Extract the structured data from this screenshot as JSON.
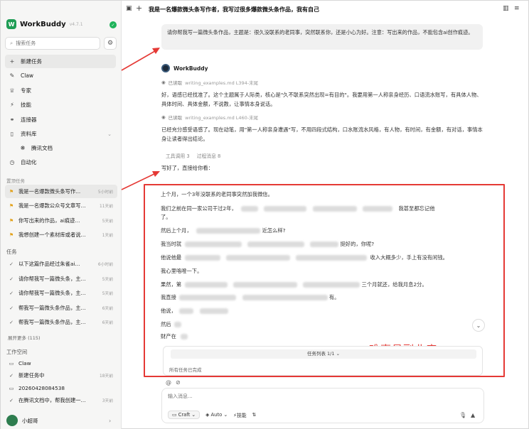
{
  "sidebar": {
    "brand_name": "WorkBuddy",
    "brand_version": "v4.7.1",
    "search_placeholder": "搜索任务",
    "nav": [
      {
        "label": "新建任务",
        "icon": "plus-icon"
      },
      {
        "label": "Claw",
        "icon": "claw-icon"
      },
      {
        "label": "专家",
        "icon": "expert-icon"
      },
      {
        "label": "技能",
        "icon": "skills-icon"
      },
      {
        "label": "连接器",
        "icon": "connector-icon"
      },
      {
        "label": "资料库",
        "icon": "library-icon"
      },
      {
        "label": "腾讯文档",
        "icon": "docs-icon"
      },
      {
        "label": "自动化",
        "icon": "automation-icon"
      }
    ],
    "pinned_label": "置顶任务",
    "pinned": [
      {
        "title": "我是一名爆款微头条写作...",
        "time": "5小时前"
      },
      {
        "title": "我是一名爆款公众号文章写...",
        "time": "11天前"
      },
      {
        "title": "你写出来的作品，ai痕迹...",
        "time": "5天前"
      },
      {
        "title": "我想创建一个素材库或者说...",
        "time": "1天前"
      }
    ],
    "tasks_label": "任务",
    "tasks": [
      {
        "title": "以下这篇作品经过朱雀ai...",
        "time": "6小时前"
      },
      {
        "title": "请你帮我写一篇微头条，主...",
        "time": "5天前"
      },
      {
        "title": "请你帮我写一篇微头条，主...",
        "time": "5天前"
      },
      {
        "title": "帮我写一篇微头条作品，主...",
        "time": "6天前"
      },
      {
        "title": "帮我写一篇微头条作品，主...",
        "time": "6天前"
      }
    ],
    "expand_more": "展开更多 (115)",
    "workspace_label": "工作空间",
    "workspace": [
      {
        "title": "Claw",
        "time": "",
        "icon": "folder-icon"
      },
      {
        "title": "新建任务中",
        "time": "18天前",
        "icon": "check-icon"
      },
      {
        "title": "20260428084538",
        "time": "",
        "icon": "folder-icon"
      },
      {
        "title": "在腾讯文档中，帮我创建一...",
        "time": "3天前",
        "icon": "check-icon"
      }
    ],
    "user_name": "小超哥"
  },
  "topbar": {
    "title": "我是一名爆款微头条写作者，我写过很多爆款微头条作品，我有自己"
  },
  "conversation": {
    "prompt": "请你帮我写一篇微头条作品，主题是：很久没联系的老同事，突然联系你，还是小心为好。注意：写出来的作品，不能包含ai创作痕迹。",
    "bot_name": "WorkBuddy",
    "read1_label": "已读取",
    "read1_file": "writing_examples.md L394-末尾",
    "para1": "好，语感已经找准了。这个主题属于人际类，核心是\"久不联系突然出现=有目的\"。我要用第一人称亲身经历、口语流水账写，有具体人物、具体时间、具体金额，不说教，让事情本身说话。",
    "read2_label": "已读取",
    "read2_file": "writing_examples.md L460-末尾",
    "para2": "已经充分感受语感了。现在动笔，用\"第一人称亲身遭遇\"写，不用四段式结构，口水账流水风格，有人物，有时间，有金额，有对话，事情本身让读者得出结论。",
    "tool_calls": "工具调用 3",
    "process_msgs": "过程消息 8",
    "intro": "写好了，直接给你看："
  },
  "article": {
    "lines": [
      "上个月，一个3年没联系的老同事突然加我微信。",
      "我们之前在同一家公司干过2年，",
      "了。",
      "然后上个月，",
      "我当时就",
      "他说他最",
      "我心里咯噔一下。",
      "果然，第",
      "我直接",
      "他说，",
      "然后",
      "财产在"
    ],
    "line1_tail": "我甚至都忘记他",
    "line3_tail": "近怎么样?",
    "line4_tail": "挺好的，你呢?",
    "line5_tail": "收入大概多少，手上有没有闲钱。",
    "line7_tail": "三个月就还，给我月息2分。",
    "line8_tail": "有。",
    "watermark": "难事易副业库"
  },
  "task_panel": {
    "header": "任务列表 1/1",
    "status": "所有任务已完成"
  },
  "composer": {
    "placeholder": "输入消息...",
    "mode": "Craft",
    "model": "Auto",
    "skills": "技能"
  },
  "colors": {
    "accent_green": "#1f9d55",
    "annotation_red": "#e53935",
    "pin_yellow": "#e2a11a"
  }
}
